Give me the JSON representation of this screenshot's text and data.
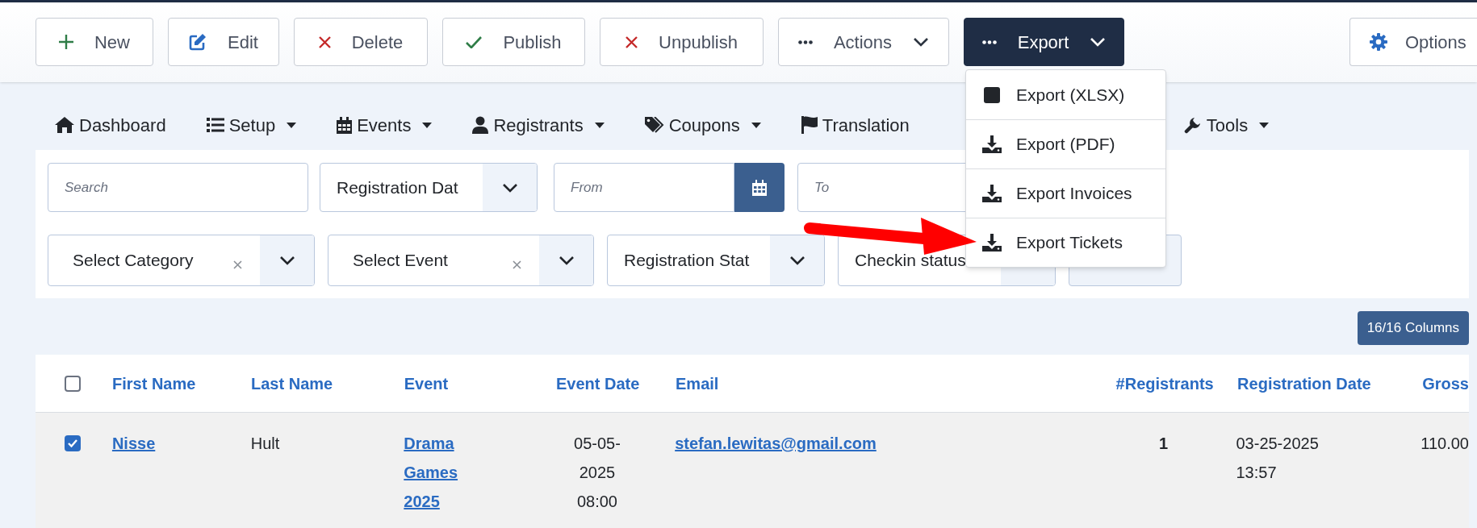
{
  "toolbar": {
    "buttons": [
      {
        "kind": "new",
        "label": "New"
      },
      {
        "kind": "edit",
        "label": "Edit"
      },
      {
        "kind": "delete",
        "label": "Delete"
      },
      {
        "kind": "publish",
        "label": "Publish"
      },
      {
        "kind": "unpublish",
        "label": "Unpublish"
      },
      {
        "kind": "actions",
        "label": "Actions"
      },
      {
        "kind": "export",
        "label": "Export"
      }
    ],
    "options": {
      "label": "Options"
    }
  },
  "export_menu": {
    "items": [
      {
        "label": "Export (XLSX)"
      },
      {
        "label": "Export (PDF)"
      },
      {
        "label": "Export Invoices"
      },
      {
        "label": "Export Tickets"
      }
    ]
  },
  "nav": {
    "items": [
      {
        "label": "Dashboard",
        "dropdown": false
      },
      {
        "label": "Setup",
        "dropdown": true
      },
      {
        "label": "Events",
        "dropdown": true
      },
      {
        "label": "Registrants",
        "dropdown": true
      },
      {
        "label": "Coupons",
        "dropdown": true
      },
      {
        "label": "Translation",
        "dropdown": false
      },
      {
        "label": "Tools",
        "dropdown": true
      }
    ]
  },
  "filters": {
    "search": {
      "placeholder": "Search"
    },
    "date_field": {
      "value": "Registration Dat"
    },
    "from": {
      "placeholder": "From"
    },
    "to": {
      "placeholder": "To"
    },
    "selects": [
      {
        "value": "Select Category",
        "clearable": true
      },
      {
        "value": "Select Event",
        "clearable": true
      },
      {
        "value": "Registration Stat",
        "clearable": false
      },
      {
        "value": "Checkin status",
        "clearable": false
      }
    ]
  },
  "columns_button": {
    "label": "16/16 Columns"
  },
  "table": {
    "select_all": {
      "checked": false
    },
    "columns": [
      "First Name",
      "Last Name",
      "Event",
      "Event Date",
      "Email",
      "#Registrants",
      "Registration Date",
      "Gross"
    ],
    "rows": [
      {
        "checked": true,
        "first_name": "Nisse",
        "last_name": "Hult",
        "event": "Drama Games 2025",
        "event_date": "05-05-2025 08:00",
        "email": "stefan.lewitas@gmail.com",
        "registrants": "1",
        "registration_date": "03-25-2025 13:57",
        "gross": "110.00"
      }
    ]
  }
}
